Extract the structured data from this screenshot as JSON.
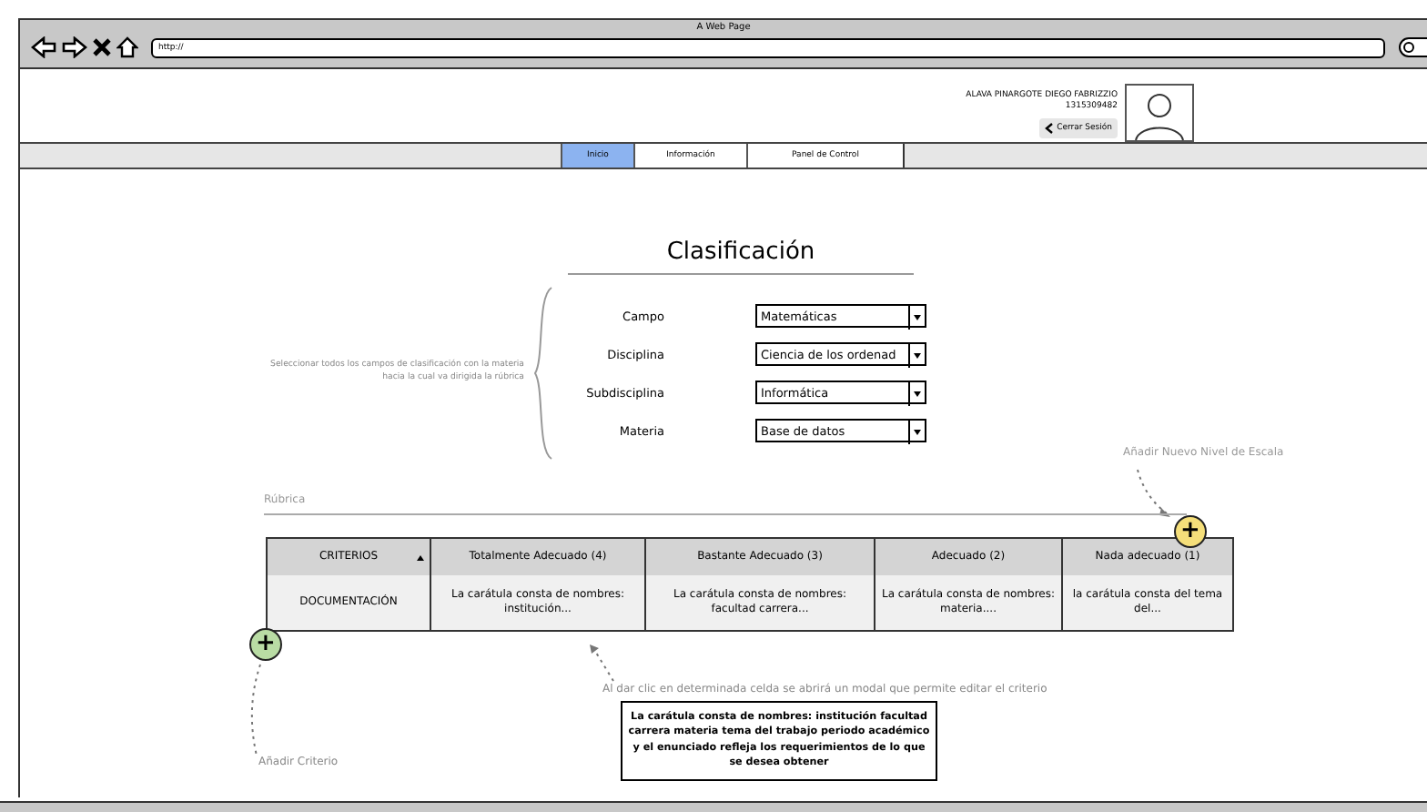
{
  "browser": {
    "title": "A Web Page",
    "url": "http://"
  },
  "user": {
    "name": "ALAVA PINARGOTE DIEGO FABRIZZIO",
    "id": "1315309482",
    "logout": "Cerrar Sesión"
  },
  "tabs": [
    {
      "label": "Inicio",
      "selected": true
    },
    {
      "label": "Información",
      "selected": false
    },
    {
      "label": "Panel de Control",
      "selected": false
    }
  ],
  "classification": {
    "title": "Clasificación",
    "note": "Seleccionar todos los campos de clasificación con la materia hacia la cual va dirigida la rúbrica",
    "fields": [
      {
        "label": "Campo",
        "value": "Matemáticas"
      },
      {
        "label": "Disciplina",
        "value": "Ciencia de los ordenad"
      },
      {
        "label": "Subdisciplina",
        "value": "Informática"
      },
      {
        "label": "Materia",
        "value": "Base de datos"
      }
    ]
  },
  "rubric": {
    "label": "Rúbrica",
    "add_level_hint": "Añadir Nuevo Nivel de Escala",
    "add_level_button": "+",
    "add_criterion_button": "+",
    "add_criterion_hint": "Añadir Criterio",
    "click_hint": "Al dar clic en determinada celda se abrirá un modal que permite editar el criterio",
    "columns": [
      "CRITERIOS",
      "Totalmente Adecuado (4)",
      "Bastante Adecuado (3)",
      "Adecuado  (2)",
      "Nada adecuado (1)"
    ],
    "rows": [
      {
        "cells": [
          "DOCUMENTACIÓN",
          "La carátula consta de nombres: institución...",
          "La carátula consta de nombres: facultad carrera...",
          "La carátula consta de nombres: materia....",
          "la carátula consta del tema del..."
        ]
      }
    ],
    "modal_text": "La carátula consta de nombres: institución facultad carrera materia tema del trabajo periodo académico y el enunciado refleja los requerimientos de lo que se desea obtener"
  }
}
